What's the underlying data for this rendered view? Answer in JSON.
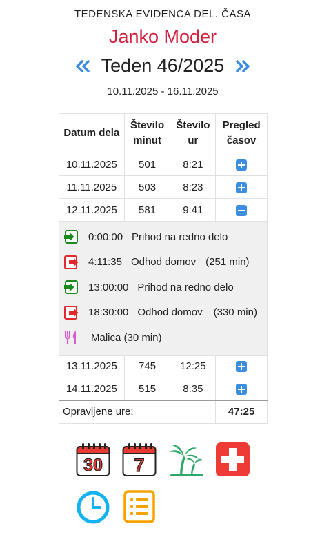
{
  "header": {
    "subtitle": "TEDENSKA EVIDENCA DEL. ČASA",
    "name": "Janko Moder",
    "week": "Teden 46/2025",
    "date_range": "10.11.2025 - 16.11.2025",
    "prev_icon": "double-chevron-left-icon",
    "next_icon": "double-chevron-right-icon"
  },
  "table": {
    "headers": [
      "Datum dela",
      "Število minut",
      "Število ur",
      "Pregled časov"
    ],
    "rows": [
      {
        "date": "10.11.2025",
        "minutes": "501",
        "hours": "8:21",
        "expanded": false
      },
      {
        "date": "11.11.2025",
        "minutes": "503",
        "hours": "8:23",
        "expanded": false
      },
      {
        "date": "12.11.2025",
        "minutes": "581",
        "hours": "9:41",
        "expanded": true
      },
      {
        "date": "13.11.2025",
        "minutes": "745",
        "hours": "12:25",
        "expanded": false
      },
      {
        "date": "14.11.2025",
        "minutes": "515",
        "hours": "8:35",
        "expanded": false
      }
    ],
    "details": [
      {
        "icon": "sign-in-icon",
        "time": "0:00:00",
        "text": "Prihod na redno delo",
        "extra": ""
      },
      {
        "icon": "sign-out-icon",
        "time": "4:11:35",
        "text": "Odhod domov",
        "extra": "(251 min)"
      },
      {
        "icon": "sign-in-icon",
        "time": "13:00:00",
        "text": "Prihod na redno delo",
        "extra": ""
      },
      {
        "icon": "sign-out-icon",
        "time": "18:30:00",
        "text": "Odhod domov",
        "extra": "(330 min)"
      },
      {
        "icon": "utensils-icon",
        "time": "",
        "text": "Malica (30 min)",
        "extra": ""
      }
    ],
    "footer": {
      "label": "Opravljene ure:",
      "value": "47:25"
    }
  },
  "shortcuts": [
    {
      "name": "calendar-month-icon",
      "label": "30"
    },
    {
      "name": "calendar-week-icon",
      "label": "7"
    },
    {
      "name": "vacation-palm-icon",
      "label": ""
    },
    {
      "name": "sick-leave-cross-icon",
      "label": ""
    },
    {
      "name": "clock-icon",
      "label": ""
    },
    {
      "name": "list-icon",
      "label": ""
    }
  ],
  "colors": {
    "name": "#d1213f",
    "accent_blue": "#3d8de0",
    "sign_in": "#1b8a1b",
    "sign_out": "#e0282e",
    "utensils": "#d45fcf",
    "calendar_red": "#e63a32",
    "palm_green": "#2ea86a",
    "sick_red": "#ee3b36",
    "clock_blue": "#14b3f0",
    "list_orange": "#f5a300"
  }
}
